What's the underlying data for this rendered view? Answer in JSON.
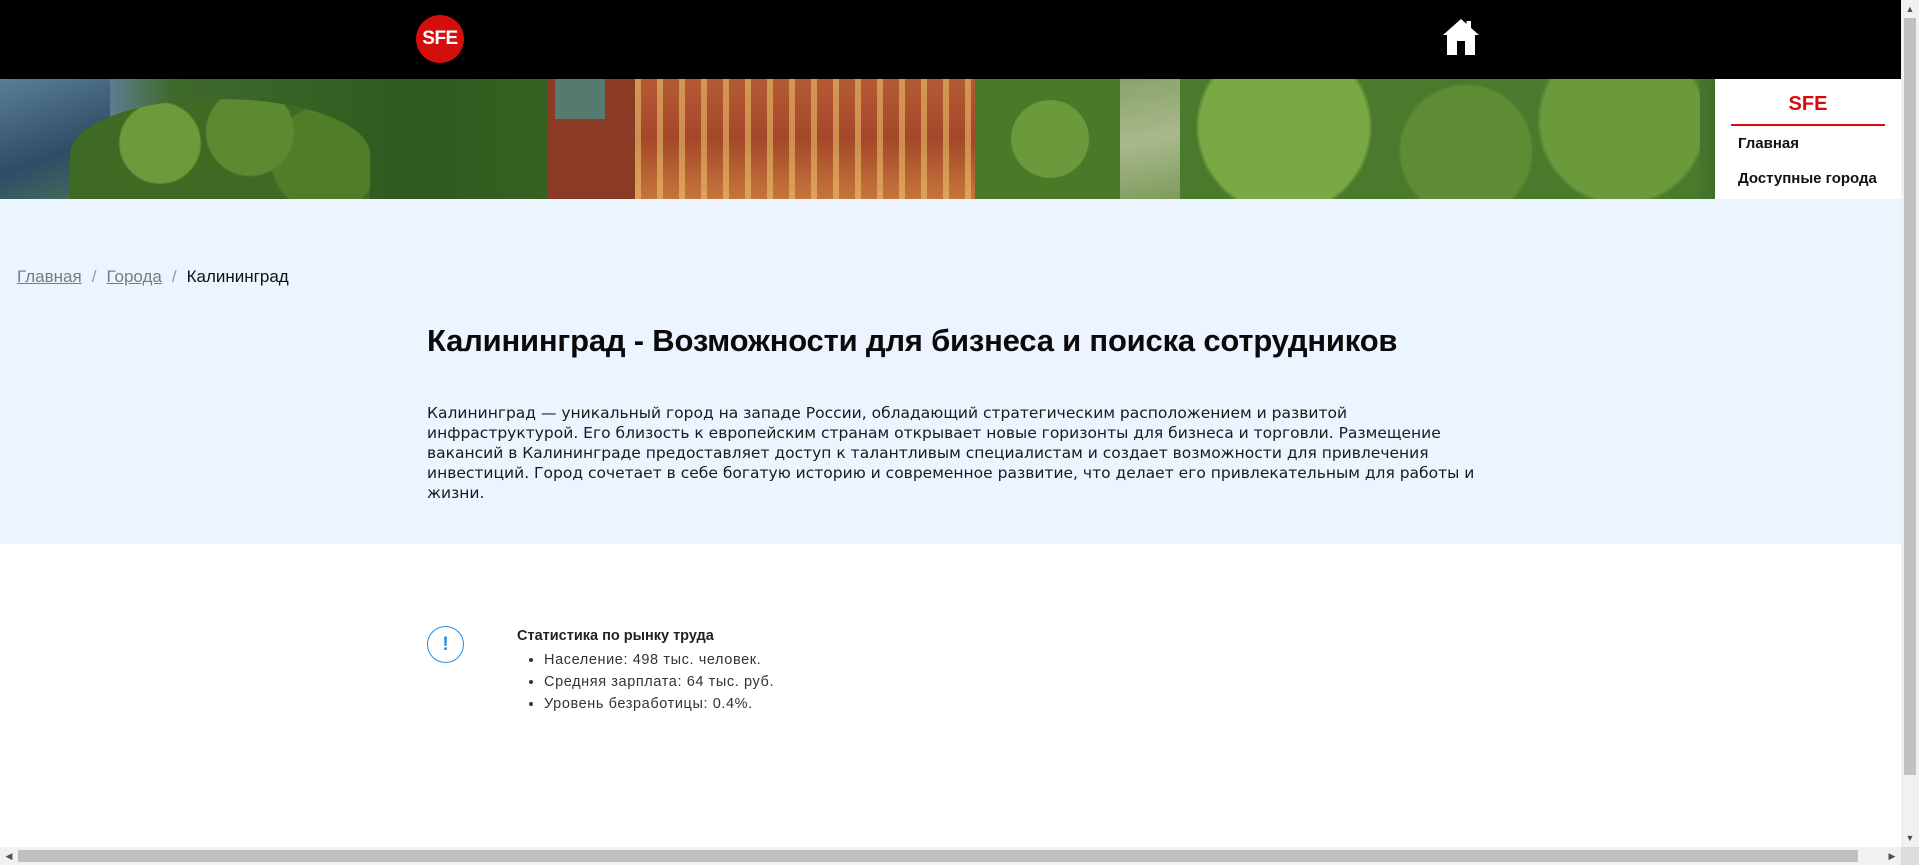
{
  "header": {
    "logo_text": "SFE",
    "logo_color": "#d40d0d",
    "home_icon": "home-icon"
  },
  "side_menu": {
    "title": "SFE",
    "items": [
      {
        "label": "Главная"
      },
      {
        "label": "Доступные города"
      }
    ]
  },
  "breadcrumb": {
    "items": [
      {
        "label": "Главная"
      },
      {
        "label": "Города"
      }
    ],
    "separator": "/",
    "current": "Калининград"
  },
  "main": {
    "title": "Калининград - Возможности для бизнеса и поиска сотрудников",
    "description": "Калининград — уникальный город на западе России, обладающий стратегическим расположением и развитой инфраструктурой. Его близость к европейским странам открывает новые горизонты для бизнеса и торговли. Размещение вакансий в Калининграде предоставляет доступ к талантливым специалистам и создает возможности для привлечения инвестиций. Город сочетает в себе богатую историю и современное развитие, что делает его привлекательным для работы и жизни."
  },
  "stats": {
    "icon": "exclamation-icon",
    "icon_symbol": "!",
    "title": "Статистика по рынку труда",
    "items": [
      "Население: 498 тыс. человек.",
      "Средняя зарплата: 64 тыс. руб.",
      "Уровень безработицы: 0.4%."
    ]
  },
  "colors": {
    "accent": "#d40d0d",
    "info_bg": "#ecf4ff",
    "icon_blue": "#2a8ee0"
  }
}
